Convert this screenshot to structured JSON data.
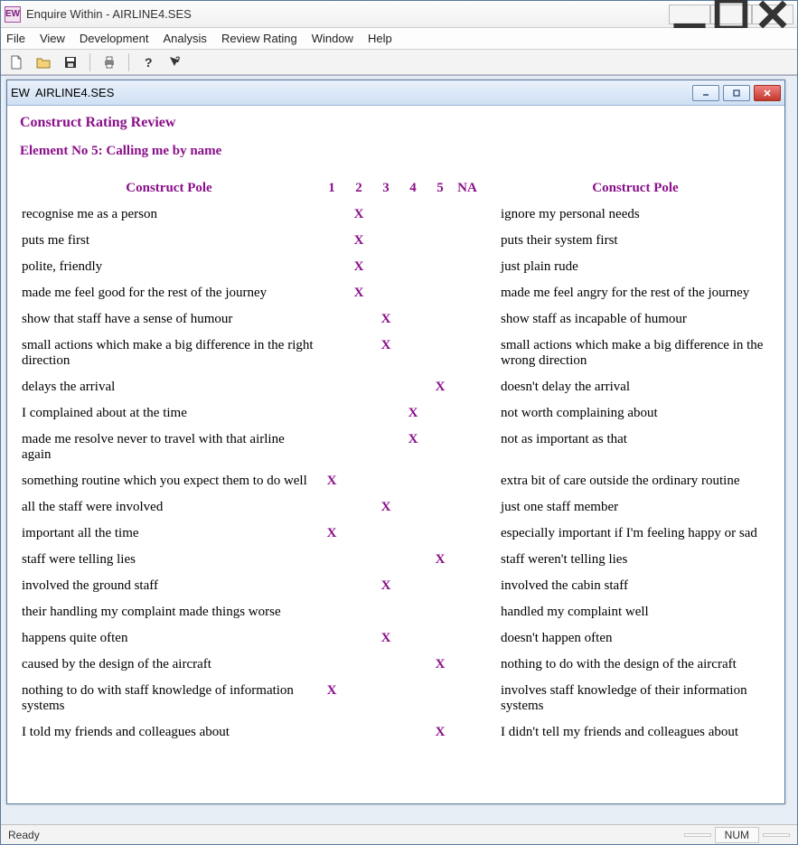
{
  "app": {
    "title": "Enquire Within - AIRLINE4.SES",
    "icon_letter": "EW"
  },
  "menu": [
    "File",
    "View",
    "Development",
    "Analysis",
    "Review Rating",
    "Window",
    "Help"
  ],
  "child": {
    "title": "AIRLINE4.SES",
    "review_title": "Construct Rating Review",
    "element_title": "Element No 5: Calling me by name",
    "headers": {
      "left": "Construct Pole",
      "right": "Construct Pole",
      "ratings": [
        "1",
        "2",
        "3",
        "4",
        "5",
        "NA"
      ]
    },
    "rows": [
      {
        "left": "recognise me as a person",
        "rating": 2,
        "right": "ignore my personal needs"
      },
      {
        "left": "puts me first",
        "rating": 2,
        "right": "puts their system first"
      },
      {
        "left": "polite, friendly",
        "rating": 2,
        "right": "just plain rude"
      },
      {
        "left": "made me feel good for the rest of the journey",
        "rating": 2,
        "right": "made me feel angry for the rest of the journey"
      },
      {
        "left": "show that staff have a sense of humour",
        "rating": 3,
        "right": "show staff as incapable of humour"
      },
      {
        "left": "small actions which make a big difference in the right direction",
        "rating": 3,
        "right": "small actions which make a big difference in the wrong direction"
      },
      {
        "left": "delays the arrival",
        "rating": 5,
        "right": "doesn't delay the arrival"
      },
      {
        "left": "I complained about at the time",
        "rating": 4,
        "right": "not worth complaining about"
      },
      {
        "left": "made me resolve never to travel with that airline again",
        "rating": 4,
        "right": "not as important as that"
      },
      {
        "left": "something routine which you expect them to do well",
        "rating": 1,
        "right": "extra bit of care outside the ordinary routine"
      },
      {
        "left": "all the staff were involved",
        "rating": 3,
        "right": "just one staff member"
      },
      {
        "left": "important all the time",
        "rating": 1,
        "right": "especially important if I'm feeling happy or sad"
      },
      {
        "left": "staff were telling lies",
        "rating": 5,
        "right": "staff weren't telling lies"
      },
      {
        "left": "involved the ground staff",
        "rating": 3,
        "right": "involved the cabin staff"
      },
      {
        "left": "their handling my complaint made things worse",
        "rating": null,
        "right": "handled my complaint well"
      },
      {
        "left": "happens quite often",
        "rating": 3,
        "right": "doesn't happen often"
      },
      {
        "left": "caused by the design of the aircraft",
        "rating": 5,
        "right": "nothing to do with the design of the aircraft"
      },
      {
        "left": "nothing to do with staff knowledge of information systems",
        "rating": 1,
        "right": "involves staff knowledge of their information systems"
      },
      {
        "left": "I told my friends and colleagues about",
        "rating": 5,
        "right": "I didn't tell my friends and colleagues about"
      }
    ]
  },
  "status": {
    "left": "Ready",
    "num": "NUM"
  }
}
